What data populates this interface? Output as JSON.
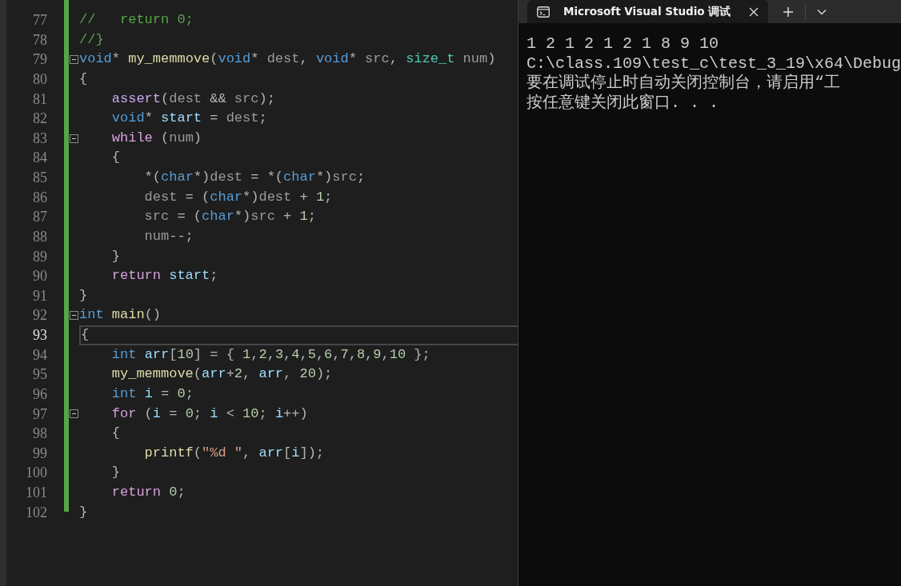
{
  "editor": {
    "lines": [
      {
        "number": "77",
        "current": false,
        "foldable": false,
        "tokens": [
          {
            "kind": "comment",
            "text": "//   return 0;"
          }
        ]
      },
      {
        "number": "78",
        "current": false,
        "foldable": false,
        "tokens": [
          {
            "kind": "comment",
            "text": "//}"
          }
        ]
      },
      {
        "number": "79",
        "current": false,
        "foldable": true,
        "tokens": [
          {
            "kind": "keyword",
            "text": "void"
          },
          {
            "kind": "plain",
            "text": "* "
          },
          {
            "kind": "function",
            "text": "my_memmove"
          },
          {
            "kind": "plain",
            "text": "("
          },
          {
            "kind": "keyword",
            "text": "void"
          },
          {
            "kind": "plain",
            "text": "* "
          },
          {
            "kind": "param",
            "text": "dest"
          },
          {
            "kind": "plain",
            "text": ", "
          },
          {
            "kind": "keyword",
            "text": "void"
          },
          {
            "kind": "plain",
            "text": "* "
          },
          {
            "kind": "param",
            "text": "src"
          },
          {
            "kind": "plain",
            "text": ", "
          },
          {
            "kind": "type",
            "text": "size_t "
          },
          {
            "kind": "param",
            "text": "num"
          },
          {
            "kind": "plain",
            "text": ")"
          }
        ]
      },
      {
        "number": "80",
        "current": false,
        "foldable": false,
        "tokens": [
          {
            "kind": "plain",
            "text": "{"
          }
        ]
      },
      {
        "number": "81",
        "current": false,
        "foldable": false,
        "tokens": [
          {
            "kind": "macro",
            "text": "    assert"
          },
          {
            "kind": "plain",
            "text": "("
          },
          {
            "kind": "param",
            "text": "dest"
          },
          {
            "kind": "plain",
            "text": " && "
          },
          {
            "kind": "param",
            "text": "src"
          },
          {
            "kind": "plain",
            "text": ");"
          }
        ]
      },
      {
        "number": "82",
        "current": false,
        "foldable": false,
        "tokens": [
          {
            "kind": "keyword",
            "text": "    void"
          },
          {
            "kind": "plain",
            "text": "* "
          },
          {
            "kind": "local",
            "text": "start"
          },
          {
            "kind": "plain",
            "text": " = "
          },
          {
            "kind": "param",
            "text": "dest"
          },
          {
            "kind": "plain",
            "text": ";"
          }
        ]
      },
      {
        "number": "83",
        "current": false,
        "foldable": true,
        "tokens": [
          {
            "kind": "control",
            "text": "    while"
          },
          {
            "kind": "plain",
            "text": " ("
          },
          {
            "kind": "param",
            "text": "num"
          },
          {
            "kind": "plain",
            "text": ")"
          }
        ]
      },
      {
        "number": "84",
        "current": false,
        "foldable": false,
        "tokens": [
          {
            "kind": "plain",
            "text": "    {"
          }
        ]
      },
      {
        "number": "85",
        "current": false,
        "foldable": false,
        "tokens": [
          {
            "kind": "plain",
            "text": "        *("
          },
          {
            "kind": "keyword",
            "text": "char"
          },
          {
            "kind": "plain",
            "text": "*)"
          },
          {
            "kind": "param",
            "text": "dest"
          },
          {
            "kind": "plain",
            "text": " = *("
          },
          {
            "kind": "keyword",
            "text": "char"
          },
          {
            "kind": "plain",
            "text": "*)"
          },
          {
            "kind": "param",
            "text": "src"
          },
          {
            "kind": "plain",
            "text": ";"
          }
        ]
      },
      {
        "number": "86",
        "current": false,
        "foldable": false,
        "tokens": [
          {
            "kind": "param",
            "text": "        dest"
          },
          {
            "kind": "plain",
            "text": " = ("
          },
          {
            "kind": "keyword",
            "text": "char"
          },
          {
            "kind": "plain",
            "text": "*)"
          },
          {
            "kind": "param",
            "text": "dest"
          },
          {
            "kind": "plain",
            "text": " + "
          },
          {
            "kind": "number",
            "text": "1"
          },
          {
            "kind": "plain",
            "text": ";"
          }
        ]
      },
      {
        "number": "87",
        "current": false,
        "foldable": false,
        "tokens": [
          {
            "kind": "param",
            "text": "        src"
          },
          {
            "kind": "plain",
            "text": " = ("
          },
          {
            "kind": "keyword",
            "text": "char"
          },
          {
            "kind": "plain",
            "text": "*)"
          },
          {
            "kind": "param",
            "text": "src"
          },
          {
            "kind": "plain",
            "text": " + "
          },
          {
            "kind": "number",
            "text": "1"
          },
          {
            "kind": "plain",
            "text": ";"
          }
        ]
      },
      {
        "number": "88",
        "current": false,
        "foldable": false,
        "tokens": [
          {
            "kind": "param",
            "text": "        num"
          },
          {
            "kind": "plain",
            "text": "--;"
          }
        ]
      },
      {
        "number": "89",
        "current": false,
        "foldable": false,
        "tokens": [
          {
            "kind": "plain",
            "text": "    }"
          }
        ]
      },
      {
        "number": "90",
        "current": false,
        "foldable": false,
        "tokens": [
          {
            "kind": "control",
            "text": "    return "
          },
          {
            "kind": "local",
            "text": "start"
          },
          {
            "kind": "plain",
            "text": ";"
          }
        ]
      },
      {
        "number": "91",
        "current": false,
        "foldable": false,
        "tokens": [
          {
            "kind": "plain",
            "text": "}"
          }
        ]
      },
      {
        "number": "92",
        "current": false,
        "foldable": true,
        "tokens": [
          {
            "kind": "keyword",
            "text": "int "
          },
          {
            "kind": "function",
            "text": "main"
          },
          {
            "kind": "plain",
            "text": "()"
          }
        ]
      },
      {
        "number": "93",
        "current": true,
        "foldable": false,
        "tokens": [
          {
            "kind": "plain",
            "text": "{"
          }
        ]
      },
      {
        "number": "94",
        "current": false,
        "foldable": false,
        "tokens": [
          {
            "kind": "keyword",
            "text": "    int "
          },
          {
            "kind": "local",
            "text": "arr"
          },
          {
            "kind": "plain",
            "text": "["
          },
          {
            "kind": "number",
            "text": "10"
          },
          {
            "kind": "plain",
            "text": "] = { "
          },
          {
            "kind": "number",
            "text": "1"
          },
          {
            "kind": "plain",
            "text": ","
          },
          {
            "kind": "number",
            "text": "2"
          },
          {
            "kind": "plain",
            "text": ","
          },
          {
            "kind": "number",
            "text": "3"
          },
          {
            "kind": "plain",
            "text": ","
          },
          {
            "kind": "number",
            "text": "4"
          },
          {
            "kind": "plain",
            "text": ","
          },
          {
            "kind": "number",
            "text": "5"
          },
          {
            "kind": "plain",
            "text": ","
          },
          {
            "kind": "number",
            "text": "6"
          },
          {
            "kind": "plain",
            "text": ","
          },
          {
            "kind": "number",
            "text": "7"
          },
          {
            "kind": "plain",
            "text": ","
          },
          {
            "kind": "number",
            "text": "8"
          },
          {
            "kind": "plain",
            "text": ","
          },
          {
            "kind": "number",
            "text": "9"
          },
          {
            "kind": "plain",
            "text": ","
          },
          {
            "kind": "number",
            "text": "10"
          },
          {
            "kind": "plain",
            "text": " };"
          }
        ]
      },
      {
        "number": "95",
        "current": false,
        "foldable": false,
        "tokens": [
          {
            "kind": "function",
            "text": "    my_memmove"
          },
          {
            "kind": "plain",
            "text": "("
          },
          {
            "kind": "local",
            "text": "arr"
          },
          {
            "kind": "plain",
            "text": "+"
          },
          {
            "kind": "number",
            "text": "2"
          },
          {
            "kind": "plain",
            "text": ", "
          },
          {
            "kind": "local",
            "text": "arr"
          },
          {
            "kind": "plain",
            "text": ", "
          },
          {
            "kind": "number",
            "text": "20"
          },
          {
            "kind": "plain",
            "text": ");"
          }
        ]
      },
      {
        "number": "96",
        "current": false,
        "foldable": false,
        "tokens": [
          {
            "kind": "keyword",
            "text": "    int "
          },
          {
            "kind": "local",
            "text": "i"
          },
          {
            "kind": "plain",
            "text": " = "
          },
          {
            "kind": "number",
            "text": "0"
          },
          {
            "kind": "plain",
            "text": ";"
          }
        ]
      },
      {
        "number": "97",
        "current": false,
        "foldable": true,
        "tokens": [
          {
            "kind": "control",
            "text": "    for"
          },
          {
            "kind": "plain",
            "text": " ("
          },
          {
            "kind": "local",
            "text": "i"
          },
          {
            "kind": "plain",
            "text": " = "
          },
          {
            "kind": "number",
            "text": "0"
          },
          {
            "kind": "plain",
            "text": "; "
          },
          {
            "kind": "local",
            "text": "i"
          },
          {
            "kind": "plain",
            "text": " < "
          },
          {
            "kind": "number",
            "text": "10"
          },
          {
            "kind": "plain",
            "text": "; "
          },
          {
            "kind": "local",
            "text": "i"
          },
          {
            "kind": "plain",
            "text": "++)"
          }
        ]
      },
      {
        "number": "98",
        "current": false,
        "foldable": false,
        "tokens": [
          {
            "kind": "plain",
            "text": "    {"
          }
        ]
      },
      {
        "number": "99",
        "current": false,
        "foldable": false,
        "tokens": [
          {
            "kind": "function",
            "text": "        printf"
          },
          {
            "kind": "plain",
            "text": "("
          },
          {
            "kind": "string",
            "text": "\"%d \""
          },
          {
            "kind": "plain",
            "text": ", "
          },
          {
            "kind": "local",
            "text": "arr"
          },
          {
            "kind": "plain",
            "text": "["
          },
          {
            "kind": "local",
            "text": "i"
          },
          {
            "kind": "plain",
            "text": "]);"
          }
        ]
      },
      {
        "number": "100",
        "current": false,
        "foldable": false,
        "tokens": [
          {
            "kind": "plain",
            "text": "    }"
          }
        ]
      },
      {
        "number": "101",
        "current": false,
        "foldable": false,
        "tokens": [
          {
            "kind": "control",
            "text": "    return "
          },
          {
            "kind": "number",
            "text": "0"
          },
          {
            "kind": "plain",
            "text": ";"
          }
        ]
      },
      {
        "number": "102",
        "current": false,
        "foldable": false,
        "tokens": [
          {
            "kind": "plain",
            "text": "}"
          }
        ]
      }
    ]
  },
  "terminal": {
    "tabs": [
      {
        "title": "Microsoft Visual Studio 调试",
        "selected": true
      }
    ],
    "lines": [
      "1 2 1 2 1 2 1 8 9 10",
      "C:\\class.109\\test_c\\test_3_19\\x64\\Debug",
      "要在调试停止时自动关闭控制台，请启用“工",
      "按任意键关闭此窗口. . ."
    ]
  }
}
